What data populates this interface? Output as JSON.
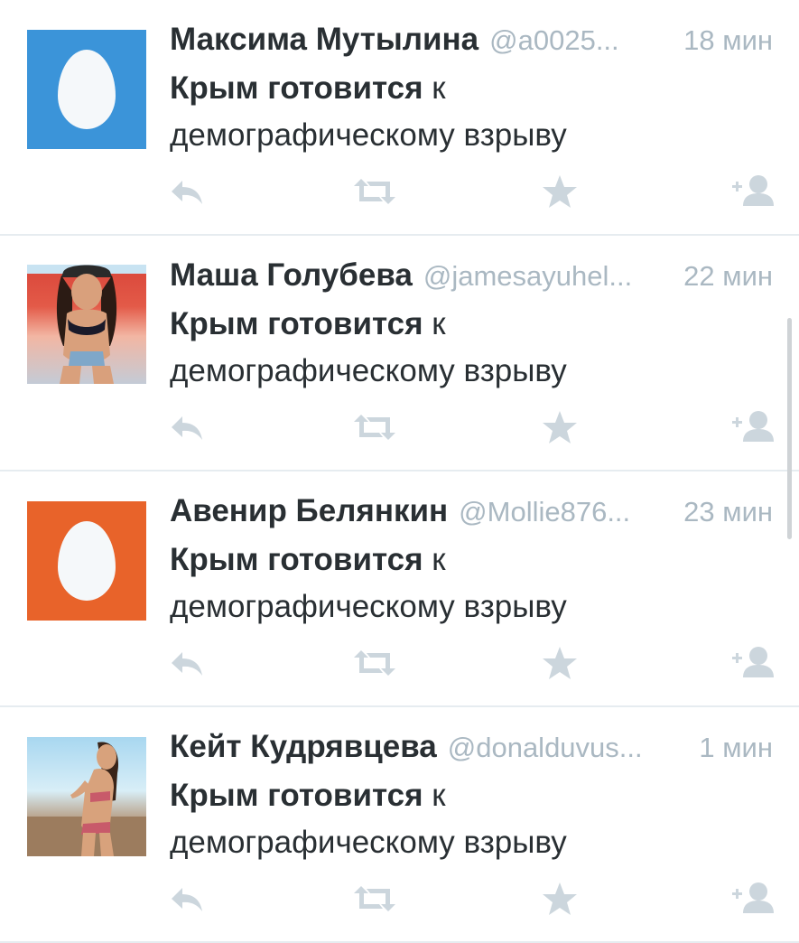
{
  "colors": {
    "name": "#292f33",
    "meta": "#aab8c2",
    "action_icon": "#ccd6dd",
    "divider": "#e6ecf0",
    "egg_blue": "#3b94d9",
    "egg_orange": "#e8632a"
  },
  "tweets": [
    {
      "name": "Максима Мутылина",
      "handle": "@a0025...",
      "time": "18 мин",
      "text_bold": "Крым готовится",
      "text_rest": " к демографическому взрыву",
      "avatar": "default-egg-blue"
    },
    {
      "name": "Маша Голубева",
      "handle": "@jamesayuhel...",
      "time": "22 мин",
      "text_bold": "Крым готовится",
      "text_rest": " к демографическому взрыву",
      "avatar": "photo"
    },
    {
      "name": "Авенир Белянкин",
      "handle": "@Mollie876...",
      "time": "23 мин",
      "text_bold": "Крым готовится",
      "text_rest": " к демографическому взрыву",
      "avatar": "default-egg-orange"
    },
    {
      "name": "Кейт Кудрявцева",
      "handle": "@donalduvus...",
      "time": "1 мин",
      "text_bold": "Крым готовится",
      "text_rest": " к демографическому взрыву",
      "avatar": "photo"
    }
  ],
  "actions": [
    "reply-icon",
    "retweet-icon",
    "favorite-icon",
    "follow-icon"
  ]
}
